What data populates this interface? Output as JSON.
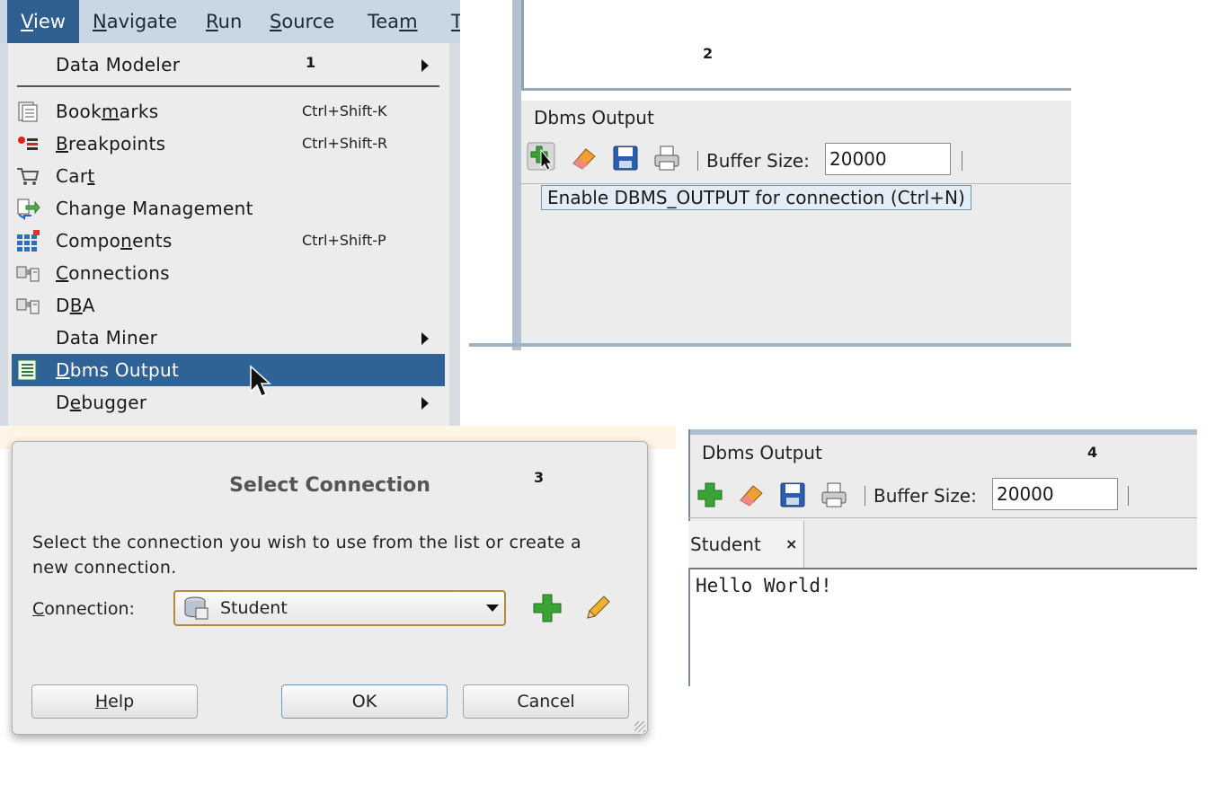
{
  "labels": {
    "one": "1",
    "two": "2",
    "three": "3",
    "four": "4"
  },
  "menubar": [
    {
      "pre": "",
      "u": "V",
      "post": "iew",
      "active": true
    },
    {
      "pre": "",
      "u": "N",
      "post": "avigate"
    },
    {
      "pre": "",
      "u": "R",
      "post": "un"
    },
    {
      "pre": "",
      "u": "S",
      "post": "ource"
    },
    {
      "pre": "Tea",
      "u": "m",
      "post": ""
    },
    {
      "pre": "",
      "u": "T",
      "post": ""
    }
  ],
  "menu": [
    {
      "pre": "Data Modeler",
      "u": "",
      "post": "",
      "shortcut": "",
      "submenu": true,
      "icon": ""
    },
    {
      "pre": "Book",
      "u": "m",
      "post": "arks",
      "shortcut": "Ctrl+Shift-K",
      "icon": "bookmarks-icon"
    },
    {
      "pre": "",
      "u": "B",
      "post": "reakpoints",
      "shortcut": "Ctrl+Shift-R",
      "icon": "breakpoints-icon"
    },
    {
      "pre": "Car",
      "u": "t",
      "post": "",
      "shortcut": "",
      "icon": "cart-icon"
    },
    {
      "pre": "Change Management",
      "u": "",
      "post": "",
      "shortcut": "",
      "icon": "change-management-icon"
    },
    {
      "pre": "Compo",
      "u": "n",
      "post": "ents",
      "shortcut": "Ctrl+Shift-P",
      "icon": "components-icon"
    },
    {
      "pre": "",
      "u": "C",
      "post": "onnections",
      "shortcut": "",
      "icon": "connections-icon"
    },
    {
      "pre": "D",
      "u": "B",
      "post": "A",
      "shortcut": "",
      "icon": "dba-icon"
    },
    {
      "pre": "Data Miner",
      "u": "",
      "post": "",
      "shortcut": "",
      "submenu": true,
      "icon": ""
    },
    {
      "pre": "",
      "u": "D",
      "post": "bms Output",
      "shortcut": "",
      "selected": true,
      "icon": "dbms-output-icon"
    },
    {
      "pre": "D",
      "u": "e",
      "post": "bugger",
      "shortcut": "",
      "submenu": true,
      "icon": ""
    }
  ],
  "panel2": {
    "title": "Dbms Output",
    "buffer_label": "Buffer Size:",
    "buffer_value": "20000",
    "tooltip": "Enable DBMS_OUTPUT for connection (Ctrl+N)"
  },
  "dialog": {
    "title": "Select Connection",
    "message": "Select the connection you wish to use from the list or create a new connection.",
    "connection_label_u": "C",
    "connection_label_rest": "onnection:",
    "connection_value": "Student",
    "help_u": "H",
    "help_rest": "elp",
    "ok": "OK",
    "cancel": "Cancel"
  },
  "panel4": {
    "title": "Dbms Output",
    "buffer_label": "Buffer Size:",
    "buffer_value": "20000",
    "tab": "Student",
    "tab_close": "×",
    "output": "Hello World!"
  },
  "colors": {
    "menu_selection": "#2f6398",
    "menubar": "#c9d6e3",
    "accent_plus": "#3aa335"
  }
}
